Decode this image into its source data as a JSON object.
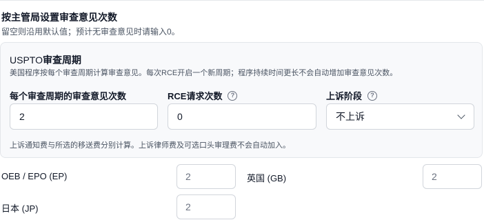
{
  "section": {
    "title": "按主管局设置审查意见次数",
    "hint": "留空则沿用默认值；预计无审查意见时请输入0。"
  },
  "uspto": {
    "title_prefix": "USPTO",
    "title_suffix": "审查周期",
    "description": "美国程序按每个审查周期计算审查意见。每次RCE开启一个新周期；程序持续时间更长不会自动增加审查意见次数。",
    "fields": {
      "oa_per_cycle": {
        "label": "每个审查周期的审查意见次数",
        "value": "2"
      },
      "rce_count": {
        "label": "RCE请求次数",
        "value": "0",
        "help_icon": "help-circle-icon"
      },
      "appeal_stage": {
        "label": "上诉阶段",
        "value": "不上诉",
        "help_icon": "help-circle-icon"
      }
    },
    "note": "上诉通知费与所选的移送费分别计算。上诉律师费及可选口头审理费不会自动加入。"
  },
  "offices": [
    {
      "label": "OEB / EPO (EP)",
      "placeholder": "2"
    },
    {
      "label": "英国 (GB)",
      "placeholder": "2"
    },
    {
      "label": "日本 (JP)",
      "placeholder": "2"
    }
  ]
}
